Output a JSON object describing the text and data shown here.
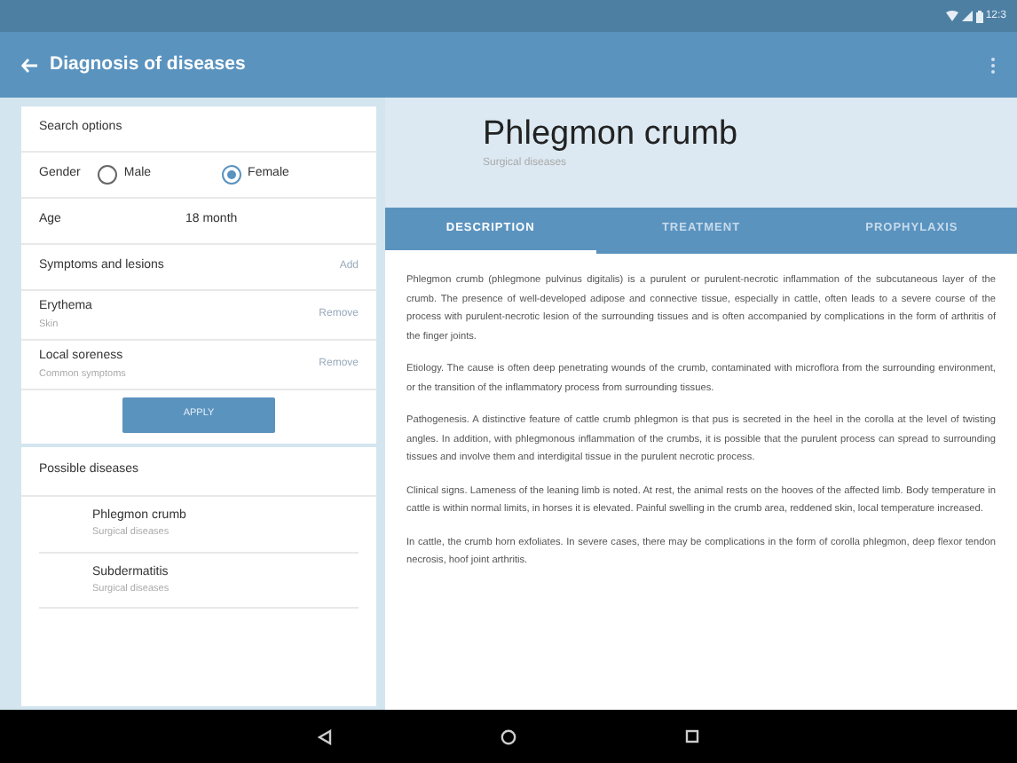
{
  "status_bar": {
    "time": "12:3"
  },
  "app_bar": {
    "title": "Diagnosis of diseases"
  },
  "search_options": {
    "title": "Search options",
    "gender": {
      "label": "Gender",
      "options": [
        {
          "label": "Male",
          "selected": false
        },
        {
          "label": "Female",
          "selected": true
        }
      ]
    },
    "age": {
      "label": "Age",
      "value": "18 month"
    },
    "symptoms": {
      "title": "Symptoms and lesions",
      "add": "Add",
      "items": [
        {
          "name": "Erythema",
          "category": "Skin",
          "action": "Remove"
        },
        {
          "name": "Local soreness",
          "category": "Common symptoms",
          "action": "Remove"
        }
      ]
    },
    "apply": "APPLY"
  },
  "possible_diseases": {
    "title": "Possible diseases",
    "items": [
      {
        "name": "Phlegmon crumb",
        "category": "Surgical diseases"
      },
      {
        "name": "Subdermatitis",
        "category": "Surgical diseases"
      }
    ]
  },
  "detail": {
    "title": "Phlegmon crumb",
    "subtitle": "Surgical diseases",
    "tabs": [
      {
        "label": "DESCRIPTION",
        "selected": true
      },
      {
        "label": "TREATMENT",
        "selected": false
      },
      {
        "label": "PROPHYLAXIS",
        "selected": false
      }
    ],
    "paragraphs": [
      "Phlegmon crumb (phlegmone pulvinus digitalis) is a purulent or purulent-necrotic inflammation of the subcutaneous layer of the crumb. The presence of well-developed adipose and connective tissue, especially in cattle, often leads to a severe course of the process with purulent-necrotic lesion of the surrounding tissues and is often accompanied by complications in the form of arthritis of the finger joints.",
      "Etiology. The cause is often deep penetrating wounds of the crumb, contaminated with microflora from the surrounding environment, or the transition of the inflammatory process from surrounding tissues.",
      "Pathogenesis. A distinctive feature of cattle crumb phlegmon is that pus is secreted in the heel in the corolla at the level of twisting angles. In addition, with phlegmonous inflammation of the crumbs, it is possible that the purulent process can spread to surrounding tissues and involve them and interdigital tissue in the purulent necrotic process.",
      "Clinical signs. Lameness of the leaning limb is noted. At rest, the animal rests on the hooves of the affected limb. Body temperature in cattle is within normal limits, in horses it is elevated. Painful swelling in the crumb area, reddened skin, local temperature increased.",
      "In cattle, the crumb horn exfoliates. In severe cases, there may be complications in the form of corolla phlegmon, deep flexor tendon necrosis, hoof joint arthritis."
    ]
  }
}
